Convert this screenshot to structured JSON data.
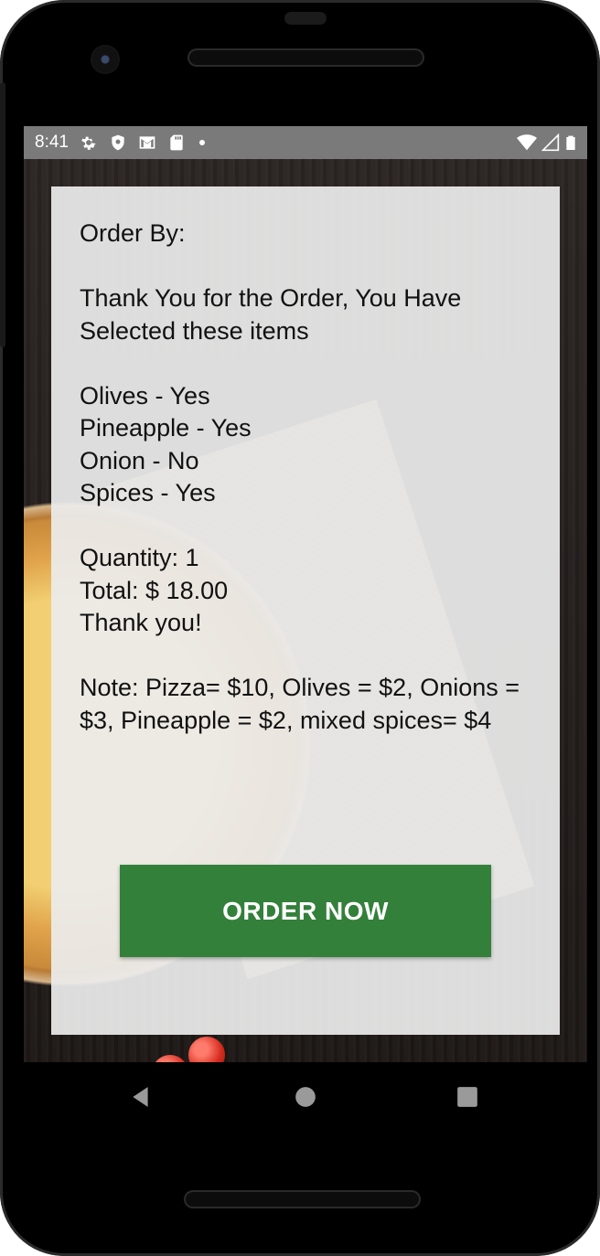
{
  "status_bar": {
    "time": "8:41",
    "left_icons": [
      "settings-icon",
      "shield-icon",
      "gmail-icon",
      "sd-card-icon",
      "dot-icon"
    ],
    "right_icons": [
      "wifi-icon",
      "signal-icon",
      "battery-icon"
    ]
  },
  "order_summary": {
    "order_by": "Order By:",
    "thank_you_message": "Thank You for the Order, You Have Selected these items",
    "items": [
      "Olives - Yes",
      "Pineapple - Yes",
      "Onion - No",
      "Spices - Yes"
    ],
    "quantity": "Quantity: 1",
    "total": "Total: $ 18.00",
    "closing": "Thank you!",
    "note": "Note: Pizza= $10, Olives = $2, Onions = $3, Pineapple = $2, mixed spices= $4"
  },
  "actions": {
    "order_button_label": "ORDER NOW"
  },
  "colors": {
    "button_green": "#33803a",
    "status_bar_gray": "#7a7a7a",
    "card_background": "#ececec"
  },
  "navigation": {
    "buttons": [
      "back-icon",
      "home-icon",
      "recents-icon"
    ]
  }
}
